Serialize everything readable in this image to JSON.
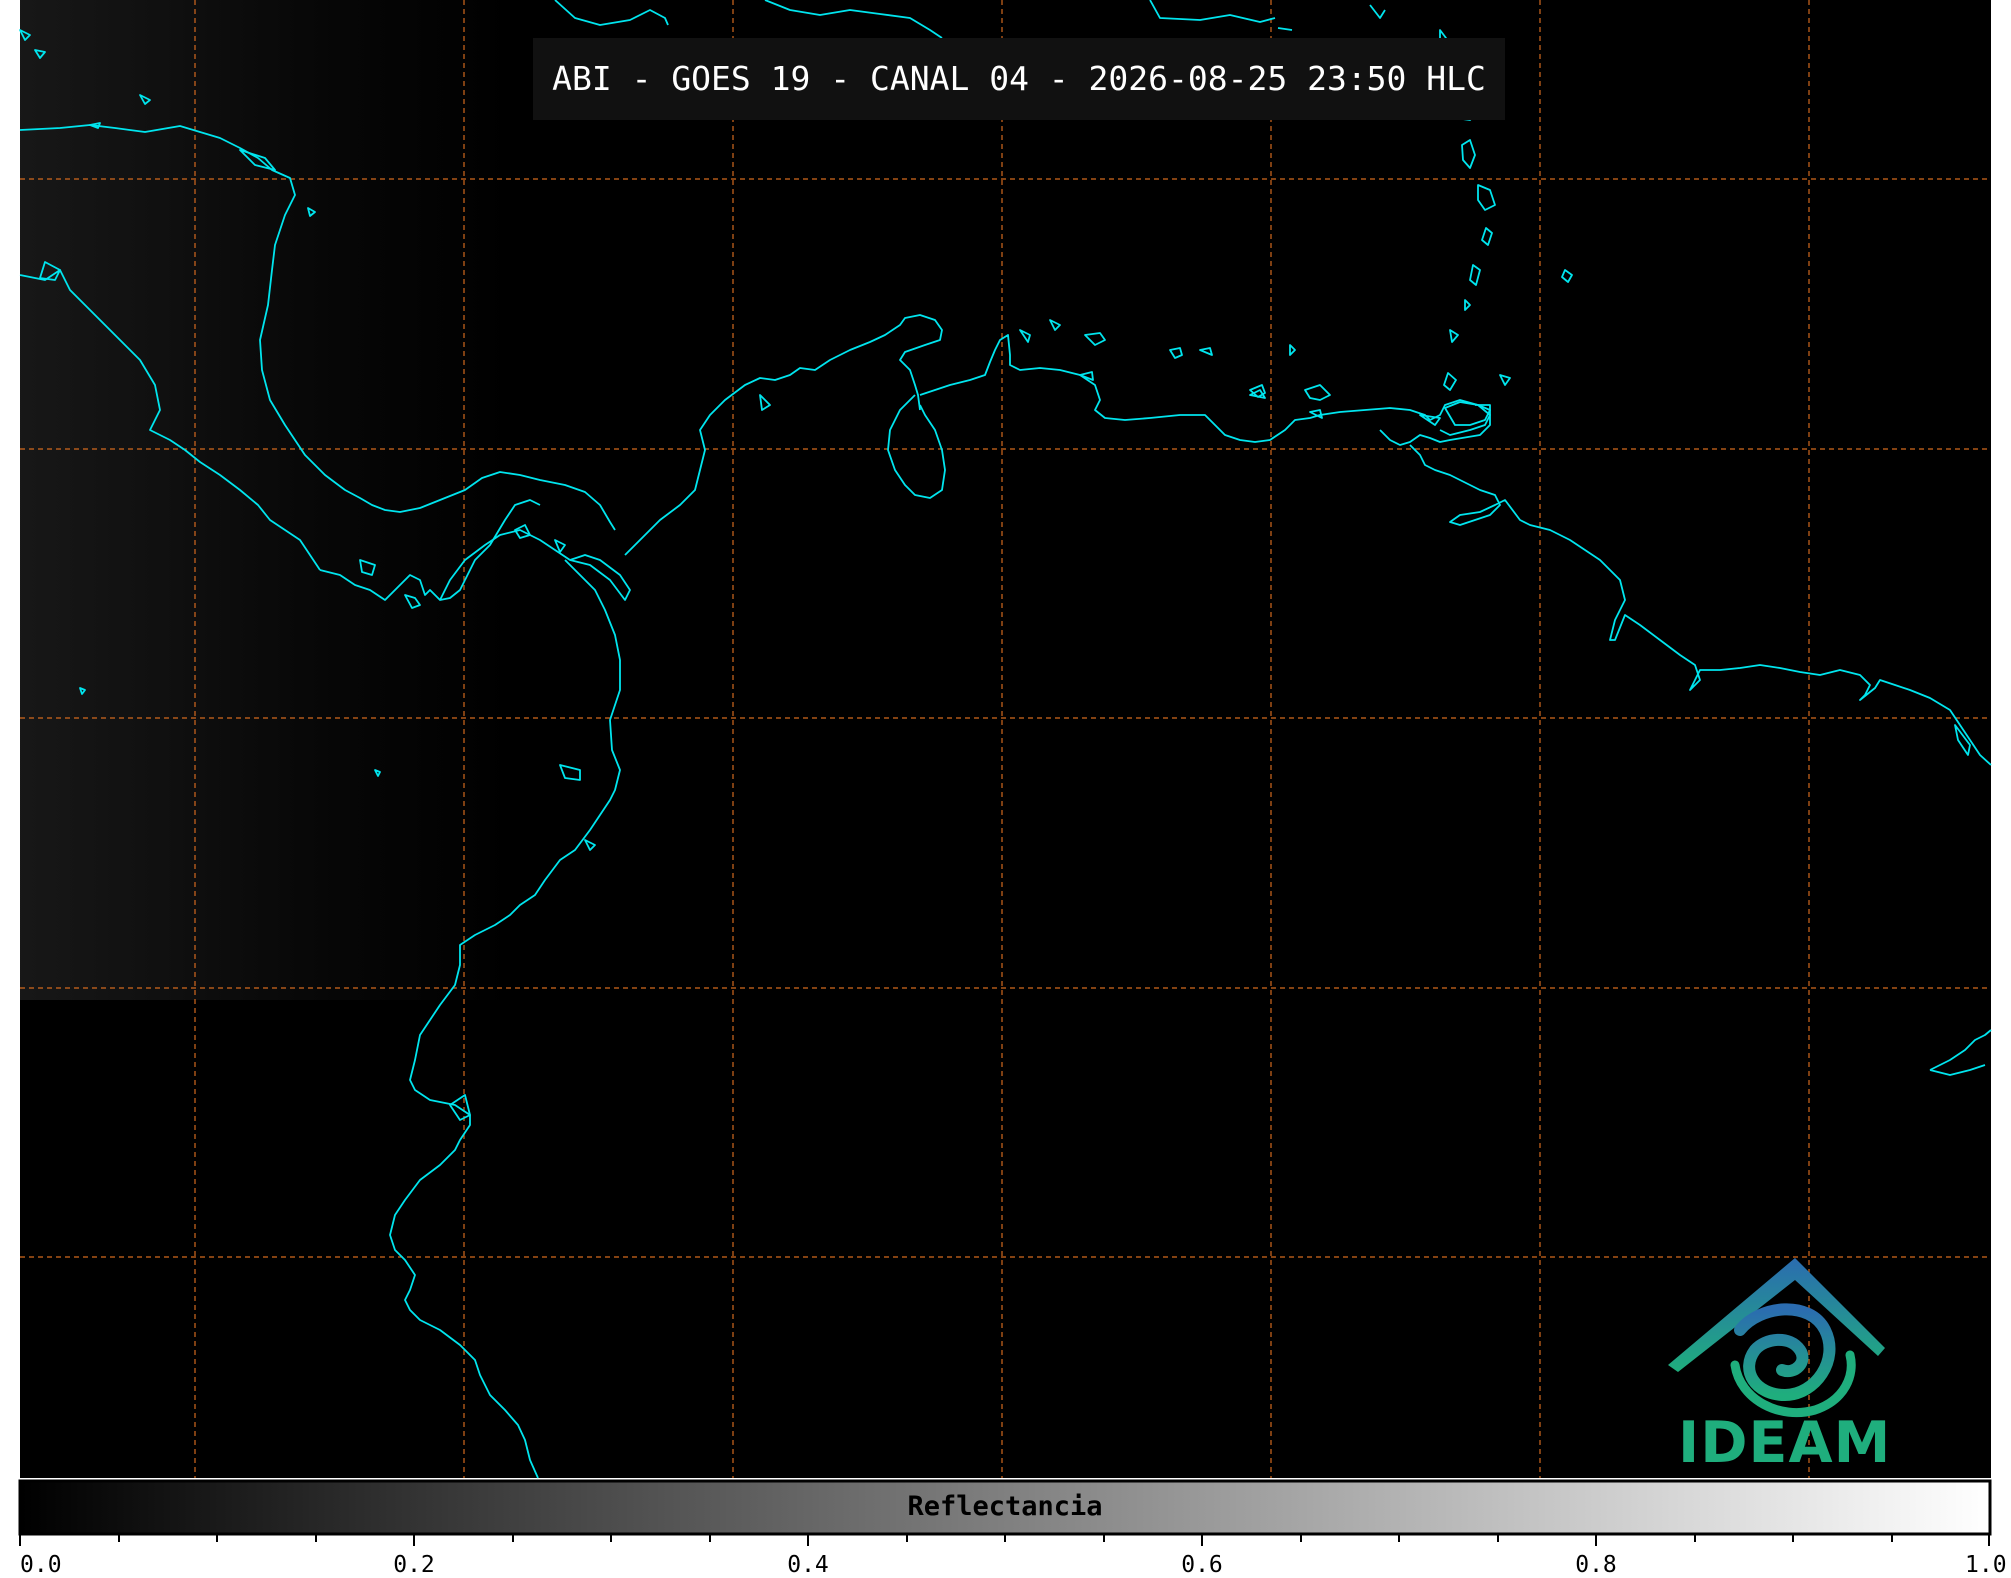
{
  "title": "ABI - GOES 19 - CANAL 04 - 2026-08-25 23:50 HLC",
  "colorbar": {
    "label": "Reflectancia",
    "ticks": [
      "0.0",
      "0.2",
      "0.4",
      "0.6",
      "0.8",
      "1.0"
    ],
    "range": [
      0.0,
      1.0
    ],
    "colormap": [
      "#000000",
      "#ffffff"
    ]
  },
  "logo": {
    "text": "IDEAM",
    "colors": [
      "#2b6cb0",
      "#1fae7d"
    ]
  },
  "colors": {
    "coastline": "#00e5ee",
    "graticule": "#d2691e",
    "background": "#000000"
  }
}
